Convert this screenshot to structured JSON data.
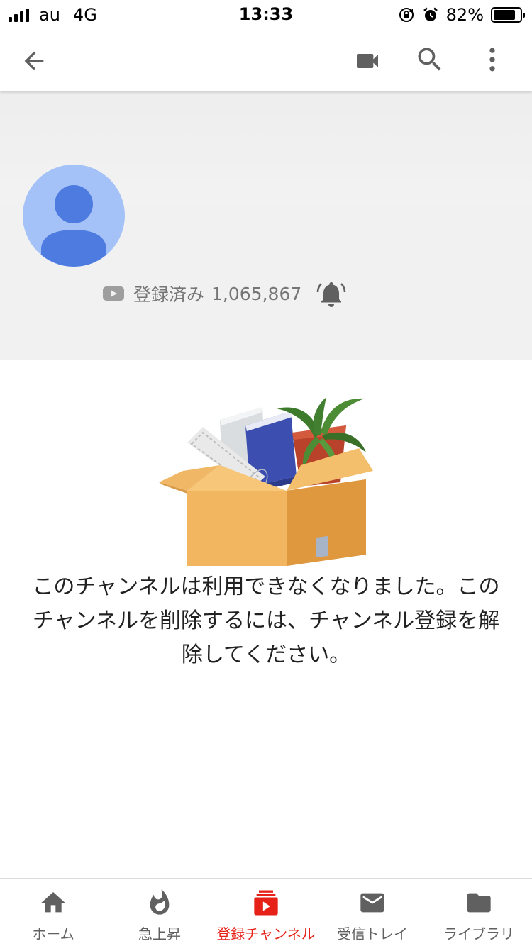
{
  "status_bar": {
    "carrier": "au",
    "network": "4G",
    "time": "13:33",
    "battery_percent_label": "82%",
    "battery_level": 0.82,
    "icons": [
      "signal-bars-icon",
      "rotation-lock-icon",
      "alarm-icon",
      "battery-icon"
    ]
  },
  "app_bar": {
    "icons": [
      "back-arrow-icon",
      "video-camera-icon",
      "search-icon",
      "more-vert-icon"
    ]
  },
  "channel": {
    "avatar_icon": "default-avatar-icon",
    "subscribed_label": "登録済み",
    "subscriber_count": "1,065,867",
    "bell_icon": "notification-bell-icon"
  },
  "empty_state": {
    "illustration": "moving-box-illustration",
    "message": "このチャンネルは利用できなくなりました。このチャンネルを削除するには、チャンネル登録を解除してください。"
  },
  "bottom_nav": {
    "items": [
      {
        "label": "ホーム",
        "icon": "home-icon",
        "active": false
      },
      {
        "label": "急上昇",
        "icon": "trending-flame-icon",
        "active": false
      },
      {
        "label": "登録チャンネル",
        "icon": "subscriptions-icon",
        "active": true
      },
      {
        "label": "受信トレイ",
        "icon": "inbox-mail-icon",
        "active": false
      },
      {
        "label": "ライブラリ",
        "icon": "library-folder-icon",
        "active": false
      }
    ]
  },
  "colors": {
    "accent_red": "#e62117",
    "avatar_bg": "#a4c1f8",
    "avatar_fg": "#4e7be0",
    "header_bg": "#f1f1f1",
    "nav_inactive": "#606060"
  }
}
